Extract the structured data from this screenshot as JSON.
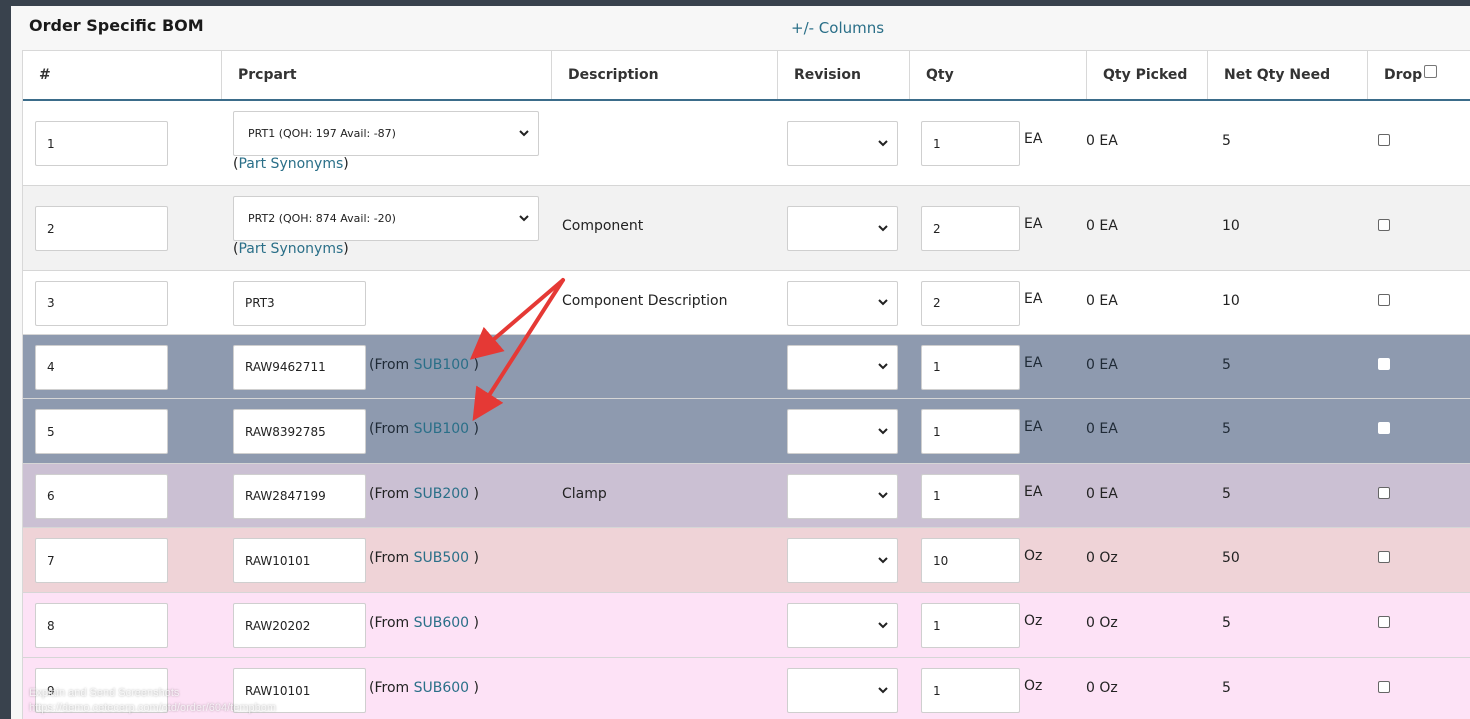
{
  "header": {
    "title": "Order Specific BOM",
    "columns_link": "+/- Columns"
  },
  "columns": [
    "#",
    "Prcpart",
    "Description",
    "Revision",
    "Qty",
    "Qty Picked",
    "Net Qty Need",
    "Drop"
  ],
  "rows": [
    {
      "num": "1",
      "part": "PRT1 (QOH: 197 Avail: -87)",
      "synonyms": "(Part Synonyms)",
      "desc": "",
      "qty": "1",
      "unit": "EA",
      "picked": "0 EA",
      "need": "5",
      "bg": "#ffffff"
    },
    {
      "num": "2",
      "part": "PRT2 (QOH: 874 Avail: -20)",
      "synonyms": "(Part Synonyms)",
      "desc": "Component",
      "qty": "2",
      "unit": "EA",
      "picked": "0 EA",
      "need": "10",
      "bg": "#f2f2f2"
    },
    {
      "num": "3",
      "part": "PRT3",
      "desc": "Component Description",
      "qty": "2",
      "unit": "EA",
      "picked": "0 EA",
      "need": "10",
      "bg": "#ffffff"
    },
    {
      "num": "4",
      "part": "RAW9462711",
      "from_prefix": "(From ",
      "from_link": "SUB100",
      "from_suffix": " )",
      "desc": "",
      "qty": "1",
      "unit": "EA",
      "picked": "0 EA",
      "need": "5",
      "bg": "#8e9aaf"
    },
    {
      "num": "5",
      "part": "RAW8392785",
      "from_prefix": "(From ",
      "from_link": "SUB100",
      "from_suffix": " )",
      "desc": "",
      "qty": "1",
      "unit": "EA",
      "picked": "0 EA",
      "need": "5",
      "bg": "#8e9aaf"
    },
    {
      "num": "6",
      "part": "RAW2847199",
      "from_prefix": "(From ",
      "from_link": "SUB200",
      "from_suffix": " )",
      "desc": "Clamp",
      "qty": "1",
      "unit": "EA",
      "picked": "0 EA",
      "need": "5",
      "bg": "#cbc0d3"
    },
    {
      "num": "7",
      "part": "RAW10101",
      "from_prefix": "(From ",
      "from_link": "SUB500",
      "from_suffix": " )",
      "desc": "",
      "qty": "10",
      "unit": "Oz",
      "picked": "0 Oz",
      "need": "50",
      "bg": "#efd3d7"
    },
    {
      "num": "8",
      "part": "RAW20202",
      "from_prefix": "(From ",
      "from_link": "SUB600",
      "from_suffix": " )",
      "desc": "",
      "qty": "1",
      "unit": "Oz",
      "picked": "0 Oz",
      "need": "5",
      "bg": "#fde2f6"
    },
    {
      "num": "9",
      "part": "RAW10101",
      "from_prefix": "(From ",
      "from_link": "SUB600",
      "from_suffix": " )",
      "desc": "",
      "qty": "1",
      "unit": "Oz",
      "picked": "0 Oz",
      "need": "5",
      "bg": "#fde2f6"
    }
  ],
  "colors": {
    "accent_link": "#2a6f88",
    "header_rule": "#3b6c8a",
    "annotation_arrow": "#e53935"
  },
  "watermark": {
    "line1": "Explain and Send Screenshots",
    "line2": "https://demo.cetecerp.com/otd/order/604/tempbom"
  }
}
